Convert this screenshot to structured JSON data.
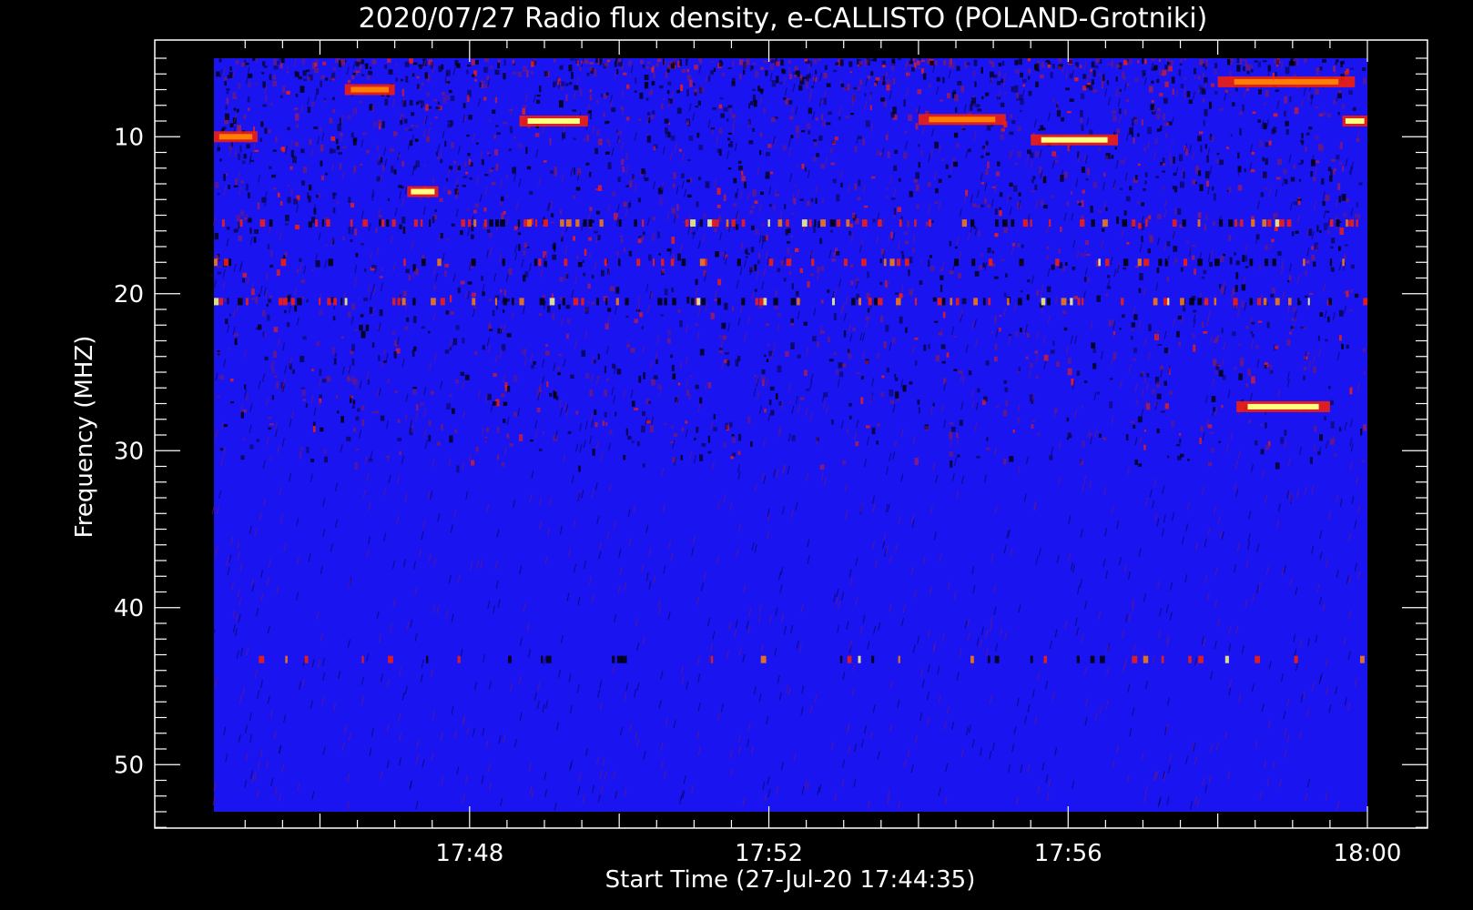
{
  "chart_data": {
    "type": "heatmap",
    "title": "2020/07/27  Radio flux density, e-CALLISTO (POLAND-Grotniki)",
    "xlabel": "Start Time (27-Jul-20 17:44:35)",
    "ylabel": "Frequency (MHZ)",
    "x_start": "17:44:35",
    "x_end": "18:00:00",
    "x_ticks": [
      "17:48",
      "17:52",
      "17:56",
      "18:00"
    ],
    "x_tick_minutes": [
      48,
      52,
      56,
      60
    ],
    "x_range_minutes": [
      44.583,
      60
    ],
    "ylim": [
      53,
      5
    ],
    "y_ticks": [
      10,
      20,
      30,
      40,
      50
    ],
    "y_tick_labels": [
      "10",
      "20",
      "30",
      "40",
      "50"
    ],
    "data_freq_range": [
      5,
      53
    ],
    "colorscale": [
      "#000000",
      "#0000ff",
      "#7a1a6a",
      "#ff2000",
      "#ff8000",
      "#ffff80",
      "#ffffff"
    ],
    "background_color": "#1a14f0",
    "features": [
      {
        "kind": "burst",
        "time_start": "17:46:20",
        "time_end": "17:47:00",
        "freq": 7.0,
        "intensity": 0.75
      },
      {
        "kind": "burst",
        "time_start": "17:48:40",
        "time_end": "17:49:35",
        "freq": 9.0,
        "intensity": 1.0
      },
      {
        "kind": "burst",
        "time_start": "17:55:30",
        "time_end": "17:56:40",
        "freq": 10.2,
        "intensity": 0.9
      },
      {
        "kind": "burst",
        "time_start": "17:58:15",
        "time_end": "17:59:30",
        "freq": 27.2,
        "intensity": 1.0
      },
      {
        "kind": "burst",
        "time_start": "17:44:35",
        "time_end": "17:45:10",
        "freq": 10.0,
        "intensity": 0.7
      },
      {
        "kind": "burst",
        "time_start": "17:47:10",
        "time_end": "17:47:35",
        "freq": 13.5,
        "intensity": 0.85
      },
      {
        "kind": "burst",
        "time_start": "17:54:00",
        "time_end": "17:55:10",
        "freq": 8.9,
        "intensity": 0.6
      },
      {
        "kind": "burst",
        "time_start": "17:58:00",
        "time_end": "17:59:50",
        "freq": 6.5,
        "intensity": 0.8
      },
      {
        "kind": "burst",
        "time_start": "17:59:40",
        "time_end": "18:00:00",
        "freq": 9.0,
        "intensity": 0.85
      },
      {
        "kind": "band",
        "freq": 15.5,
        "intensity": 0.6
      },
      {
        "kind": "band",
        "freq": 20.5,
        "intensity": 0.55
      },
      {
        "kind": "band",
        "freq": 18.0,
        "intensity": 0.35
      },
      {
        "kind": "band",
        "freq": 43.3,
        "intensity": 0.25
      }
    ]
  }
}
